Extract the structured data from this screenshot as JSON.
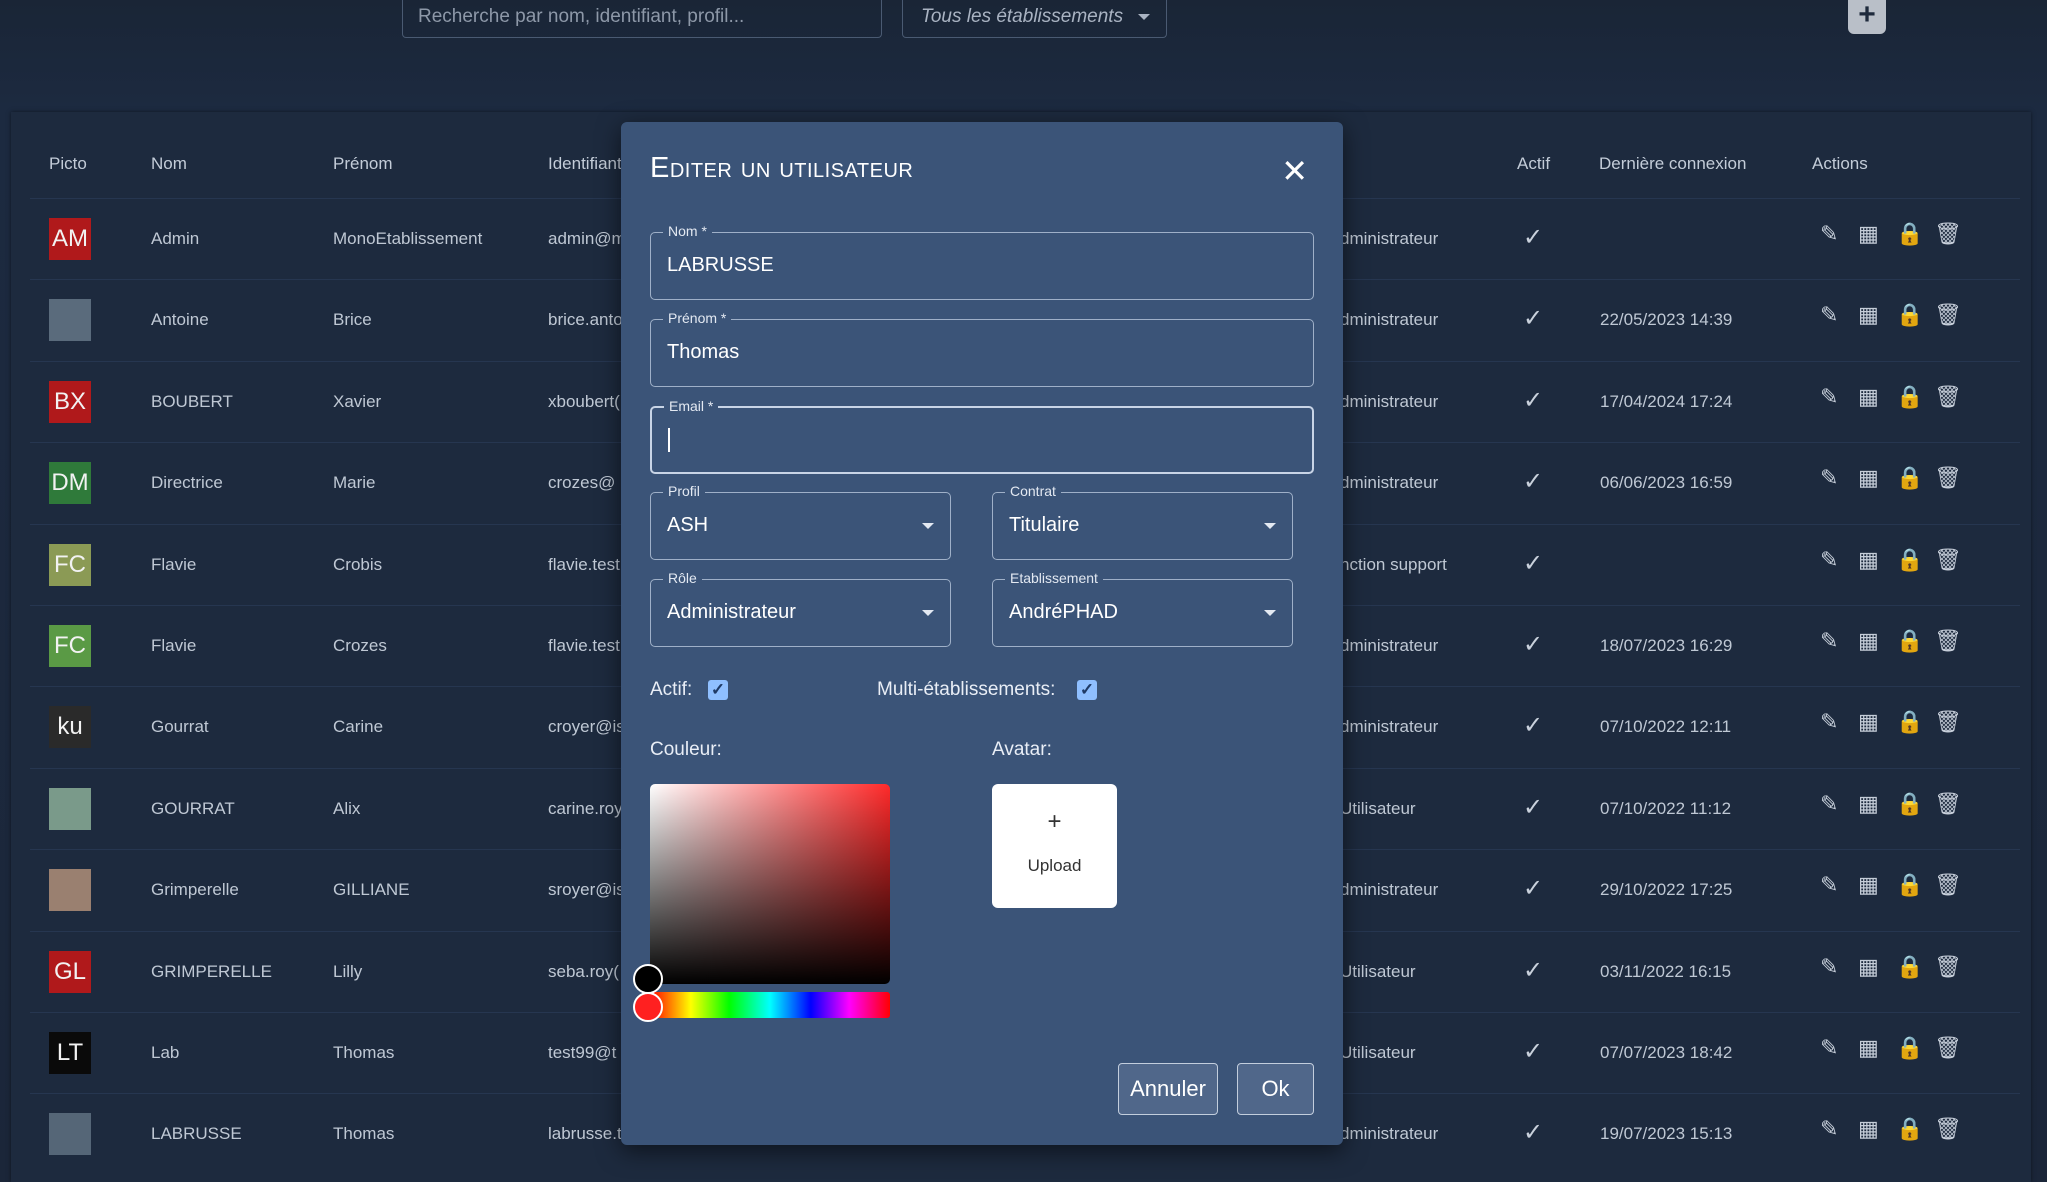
{
  "toolbar": {
    "search_placeholder": "Recherche par nom, identifiant, profil...",
    "filter_label": "Tous les établissements",
    "add_label": "+"
  },
  "table": {
    "headers": [
      "Picto",
      "Nom",
      "Prénom",
      "Identifiant",
      "Actif",
      "Dernière connexion",
      "Actions"
    ],
    "rows": [
      {
        "initials": "AM",
        "picto_color": "#b0191b",
        "nom": "Admin",
        "prenom": "MonoEtablissement",
        "identifiant": "admin@m",
        "profil": "dministrateur",
        "derniere": ""
      },
      {
        "initials": "",
        "picto_color": "#5a6b7c",
        "nom": "Antoine",
        "prenom": "Brice",
        "identifiant": "brice.anto",
        "profil": "dministrateur",
        "derniere": "22/05/2023 14:39"
      },
      {
        "initials": "BX",
        "picto_color": "#b0191b",
        "nom": "BOUBERT",
        "prenom": "Xavier",
        "identifiant": "xboubert(",
        "profil": "dministrateur",
        "derniere": "17/04/2024 17:24"
      },
      {
        "initials": "DM",
        "picto_color": "#2f7a3a",
        "nom": "Directrice",
        "prenom": "Marie",
        "identifiant": "crozes@",
        "profil": "dministrateur",
        "derniere": "06/06/2023 16:59"
      },
      {
        "initials": "FC",
        "picto_color": "#8b9a55",
        "nom": "Flavie",
        "prenom": "Crobis",
        "identifiant": "flavie.test",
        "profil": "nction support",
        "derniere": ""
      },
      {
        "initials": "FC",
        "picto_color": "#5a9a45",
        "nom": "Flavie",
        "prenom": "Crozes",
        "identifiant": "flavie.test",
        "profil": "dministrateur",
        "derniere": "18/07/2023 16:29"
      },
      {
        "initials": "ku",
        "picto_color": "#2a2a2a",
        "nom": "Gourrat",
        "prenom": "Carine",
        "identifiant": "croyer@is",
        "profil": "dministrateur",
        "derniere": "07/10/2022 12:11"
      },
      {
        "initials": "",
        "picto_color": "#7a9a8a",
        "nom": "GOURRAT",
        "prenom": "Alix",
        "identifiant": "carine.roy",
        "profil": "Utilisateur",
        "derniere": "07/10/2022 11:12"
      },
      {
        "initials": "",
        "picto_color": "#9a8070",
        "nom": "Grimperelle",
        "prenom": "GILLIANE",
        "identifiant": "sroyer@is",
        "profil": "dministrateur",
        "derniere": "29/10/2022 17:25"
      },
      {
        "initials": "GL",
        "picto_color": "#b0191b",
        "nom": "GRIMPERELLE",
        "prenom": "Lilly",
        "identifiant": "seba.roy(",
        "profil": "Utilisateur",
        "derniere": "03/11/2022 16:15"
      },
      {
        "initials": "LT",
        "picto_color": "#0a0a0a",
        "nom": "Lab",
        "prenom": "Thomas",
        "identifiant": "test99@t",
        "profil": "Utilisateur",
        "derniere": "07/07/2023 18:42"
      },
      {
        "initials": "",
        "picto_color": "#556677",
        "nom": "LABRUSSE",
        "prenom": "Thomas",
        "identifiant": "labrusse.t",
        "profil": "dministrateur",
        "derniere": "19/07/2023 15:13"
      }
    ]
  },
  "modal": {
    "title": "Editer un utilisateur",
    "close": "✕",
    "nom_label": "Nom *",
    "nom_value": "LABRUSSE",
    "prenom_label": "Prénom *",
    "prenom_value": "Thomas",
    "email_label": "Email *",
    "email_value": "",
    "profil_label": "Profil",
    "profil_value": "ASH",
    "contrat_label": "Contrat",
    "contrat_value": "Titulaire",
    "role_label": "Rôle",
    "role_value": "Administrateur",
    "etab_label": "Etablissement",
    "etab_value": "AndréPHAD",
    "actif_label": "Actif:",
    "multi_label": "Multi-établissements:",
    "couleur_label": "Couleur:",
    "avatar_label": "Avatar:",
    "upload_plus": "+",
    "upload_label": "Upload",
    "cancel_label": "Annuler",
    "ok_label": "Ok"
  },
  "colors": {
    "accent": "#3b5478",
    "checkbox": "#8fbfff",
    "danger_picto": "#b0191b"
  }
}
